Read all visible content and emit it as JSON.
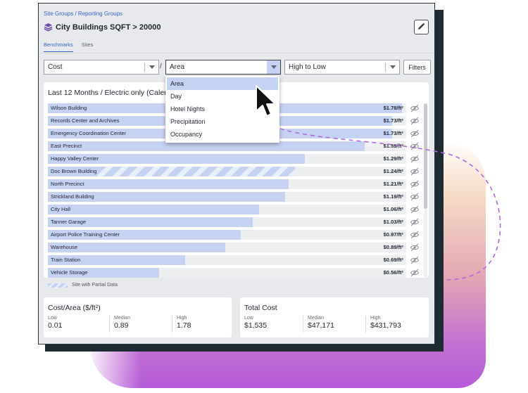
{
  "breadcrumb": "Site Groups / Reporting Groups",
  "title": "City Buildings SQFT > 20000",
  "tabs": [
    {
      "label": "Benchmarks",
      "active": true
    },
    {
      "label": "Sites",
      "active": false
    }
  ],
  "controls": {
    "metric": "Cost",
    "divider": "/",
    "normalize": "Area",
    "sort": "High to Low",
    "filters_label": "Filters"
  },
  "dropdown": {
    "options": [
      "Area",
      "Day",
      "Hotel Nights",
      "Precipitation",
      "Occupancy"
    ],
    "selected": "Area"
  },
  "chart_title": "Last 12 Months / Electric only (Calen",
  "chart_data": {
    "type": "bar",
    "orientation": "horizontal",
    "title": "Last 12 Months / Electric only (Calen",
    "unit": "/ft²",
    "xlim": [
      0,
      1.8
    ],
    "categories": [
      "Wilson Building",
      "Records Center and Archives",
      "Emergency Coordination Center",
      "East Precinct",
      "Happy Valley Center",
      "Doc Brown Building",
      "North Precinct",
      "Strickland Building",
      "City Hall",
      "Tanner Garage",
      "Airport Police Training Center",
      "Warehouse",
      "Train Station",
      "Vehicle Storage"
    ],
    "values": [
      1.78,
      1.73,
      1.73,
      1.59,
      1.29,
      1.24,
      1.21,
      1.19,
      1.06,
      1.03,
      0.97,
      0.89,
      0.69,
      0.56
    ],
    "labels": [
      "$1.78/ft²",
      "$1.73/ft²",
      "$1.73/ft²",
      "$1.59/ft²",
      "$1.29/ft²",
      "$1.24/ft²",
      "$1.21/ft²",
      "$1.19/ft²",
      "$1.06/ft²",
      "$1.03/ft²",
      "$0.97/ft²",
      "$0.89/ft²",
      "$0.69/ft²",
      "$0.56/ft²"
    ],
    "partial": [
      false,
      false,
      false,
      false,
      false,
      true,
      false,
      false,
      false,
      false,
      false,
      false,
      false,
      false
    ]
  },
  "legend_label": "Site with Partial Data",
  "cost_area": {
    "title": "Cost/Area ($/ft²)",
    "stats": [
      {
        "label": "Low",
        "value": "0.01"
      },
      {
        "label": "Median",
        "value": "0.89"
      },
      {
        "label": "High",
        "value": "1.78"
      }
    ]
  },
  "total_cost": {
    "title": "Total Cost",
    "stats": [
      {
        "label": "Low",
        "value": "$1,535"
      },
      {
        "label": "Median",
        "value": "$47,171"
      },
      {
        "label": "High",
        "value": "$431,793"
      }
    ]
  },
  "colors": {
    "accent": "#3565c7",
    "bar": "#c6d2f2",
    "dark_panel": "#1f2b33",
    "dash": "#b56ad9"
  }
}
